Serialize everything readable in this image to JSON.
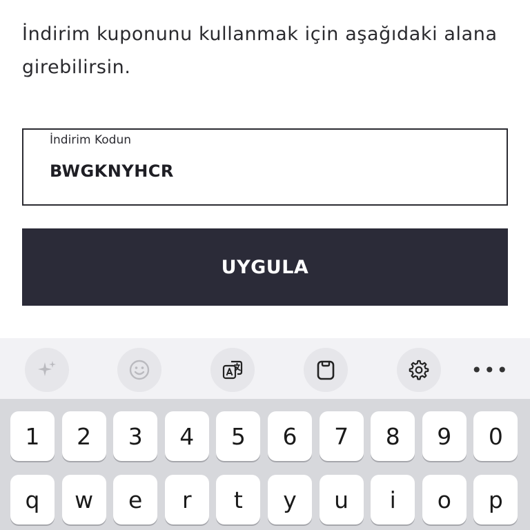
{
  "instruction": "İndirim kuponunu kullanmak için aşağıdaki alana girebilirsin.",
  "coupon": {
    "label": "İndirim Kodun",
    "value": "BWGKNYHCR"
  },
  "apply_button": "UYGULA",
  "keyboard": {
    "toolbar": [
      "sparkles-icon",
      "emoji-icon",
      "translate-icon",
      "clipboard-icon",
      "settings-icon",
      "more-icon"
    ],
    "more_label": "•••",
    "row_numbers": [
      "1",
      "2",
      "3",
      "4",
      "5",
      "6",
      "7",
      "8",
      "9",
      "0"
    ],
    "row_letters": [
      "q",
      "w",
      "e",
      "r",
      "t",
      "y",
      "u",
      "i",
      "o",
      "p"
    ]
  },
  "colors": {
    "button_bg": "#2b2b38",
    "keyboard_bg": "#d7d8dc",
    "toolbar_bg": "#f2f2f5"
  }
}
